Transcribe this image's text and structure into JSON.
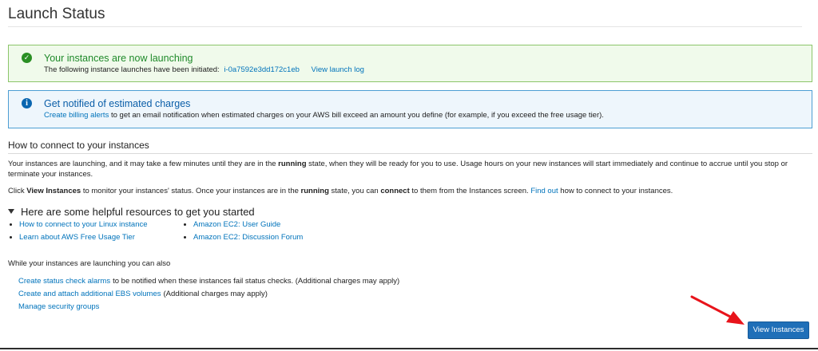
{
  "page": {
    "title": "Launch Status"
  },
  "success_alert": {
    "heading": "Your instances are now launching",
    "body_text": "The following instance launches have been initiated:",
    "instance_id": "i-0a7592e3dd172c1eb",
    "view_log_label": "View launch log",
    "icon": "check-circle-icon",
    "color": "#1f8a2a"
  },
  "info_alert": {
    "heading": "Get notified of estimated charges",
    "link_label": "Create billing alerts",
    "body_text": "to get an email notification when estimated charges on your AWS bill exceed an amount you define (for example, if you exceed the free usage tier).",
    "icon": "info-circle-icon",
    "color": "#0a5ea8"
  },
  "connect": {
    "title": "How to connect to your instances",
    "para1": {
      "before": "Your instances are launching, and it may take a few minutes until they are in the",
      "bold": "running",
      "after": "state, when they will be ready for you to use. Usage hours on your new instances will start immediately and continue to accrue until you stop or terminate your instances."
    },
    "para2": {
      "click": "Click",
      "view_instances": "View Instances",
      "text1": "to monitor your instances' status. Once your instances are in the",
      "running": "running",
      "text2": "state, you can",
      "connect": "connect",
      "text3": "to them from the Instances screen.",
      "find_out": "Find out",
      "text4": "how to connect to your instances."
    }
  },
  "resources": {
    "title": "Here are some helpful resources to get you started",
    "col1": [
      "How to connect to your Linux instance",
      "Learn about AWS Free Usage Tier"
    ],
    "col2": [
      "Amazon EC2: User Guide",
      "Amazon EC2: Discussion Forum"
    ]
  },
  "also": {
    "title": "While your instances are launching you can also",
    "items": [
      {
        "link": "Create status check alarms",
        "note": "to be notified when these instances fail status checks. (Additional charges may apply)"
      },
      {
        "link": "Create and attach additional EBS volumes",
        "note": "(Additional charges may apply)"
      },
      {
        "link": "Manage security groups",
        "note": ""
      }
    ]
  },
  "actions": {
    "view_instances_label": "View Instances",
    "button_color": "#1f6fb8"
  },
  "annotation": {
    "arrow_color": "#e8141b"
  }
}
